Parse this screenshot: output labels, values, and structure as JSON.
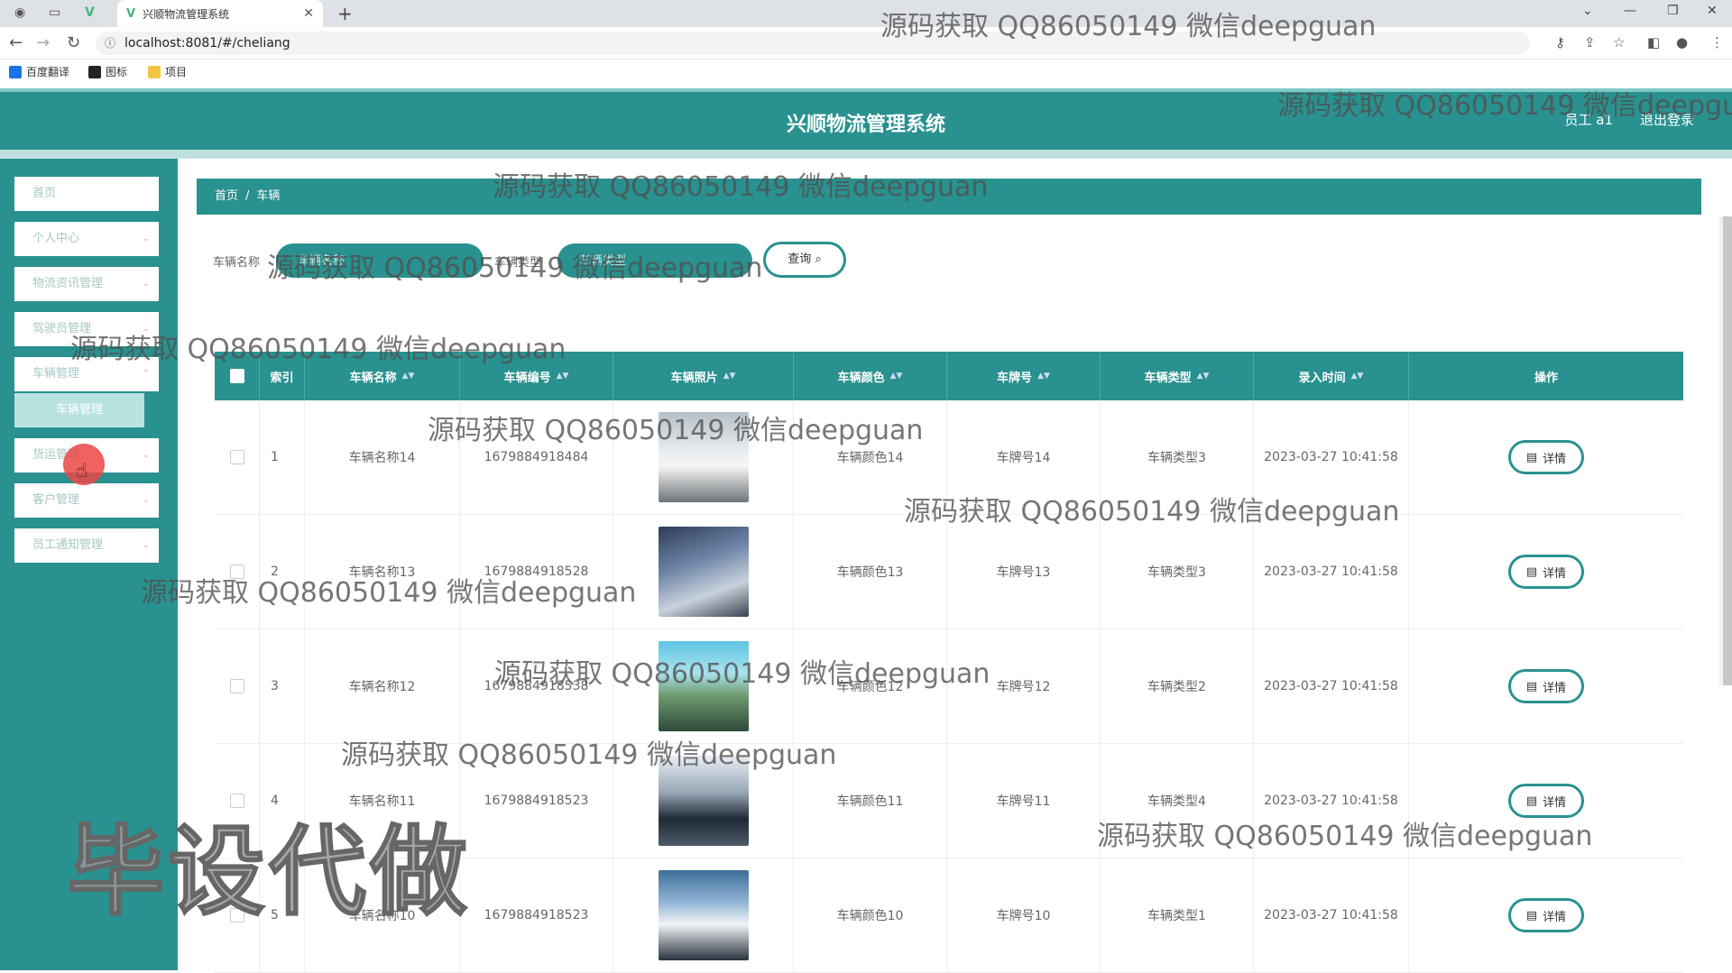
{
  "browser": {
    "tab_title": "兴顺物流管理系统",
    "url": "localhost:8081/#/cheliang",
    "bookmarks": [
      "百度翻译",
      "图标",
      "项目"
    ]
  },
  "header": {
    "title": "兴顺物流管理系统",
    "user": "员工 a1",
    "logout": "退出登录"
  },
  "sidebar": {
    "items": [
      {
        "label": "首页",
        "has_chevron": false
      },
      {
        "label": "个人中心",
        "has_chevron": true
      },
      {
        "label": "物流资讯管理",
        "has_chevron": true
      },
      {
        "label": "驾驶员管理",
        "has_chevron": true
      },
      {
        "label": "车辆管理",
        "has_chevron": true
      },
      {
        "label": "货运管理",
        "has_chevron": true
      },
      {
        "label": "客户管理",
        "has_chevron": true
      },
      {
        "label": "员工通知管理",
        "has_chevron": true
      }
    ],
    "active_sub": "车辆管理"
  },
  "breadcrumb": {
    "home": "首页",
    "current": "车辆"
  },
  "search": {
    "fields": [
      {
        "label": "车辆名称",
        "placeholder": "车辆名称"
      },
      {
        "label": "车辆类型",
        "placeholder": "车辆类型"
      }
    ],
    "button": "查询"
  },
  "table": {
    "columns": [
      "索引",
      "车辆名称",
      "车辆编号",
      "车辆照片",
      "车辆颜色",
      "车牌号",
      "车辆类型",
      "录入时间",
      "操作"
    ],
    "rows": [
      {
        "index": "1",
        "name": "车辆名称14",
        "number": "1679884918484",
        "color": "车辆颜色14",
        "plate": "车牌号14",
        "type": "车辆类型3",
        "time": "2023-03-27 10:41:58"
      },
      {
        "index": "2",
        "name": "车辆名称13",
        "number": "1679884918528",
        "color": "车辆颜色13",
        "plate": "车牌号13",
        "type": "车辆类型3",
        "time": "2023-03-27 10:41:58"
      },
      {
        "index": "3",
        "name": "车辆名称12",
        "number": "1679884918538",
        "color": "车辆颜色12",
        "plate": "车牌号12",
        "type": "车辆类型2",
        "time": "2023-03-27 10:41:58"
      },
      {
        "index": "4",
        "name": "车辆名称11",
        "number": "1679884918523",
        "color": "车辆颜色11",
        "plate": "车牌号11",
        "type": "车辆类型4",
        "time": "2023-03-27 10:41:58"
      },
      {
        "index": "5",
        "name": "车辆名称10",
        "number": "1679884918523",
        "color": "车辆颜色10",
        "plate": "车牌号10",
        "type": "车辆类型1",
        "time": "2023-03-27 10:41:58"
      }
    ],
    "action_label": "详情"
  },
  "watermarks": {
    "text": "源码获取 QQ86050149 微信deepguan",
    "big": "毕设代做"
  },
  "colors": {
    "primary": "#29918f",
    "sub_active": "#b8e3e0"
  }
}
